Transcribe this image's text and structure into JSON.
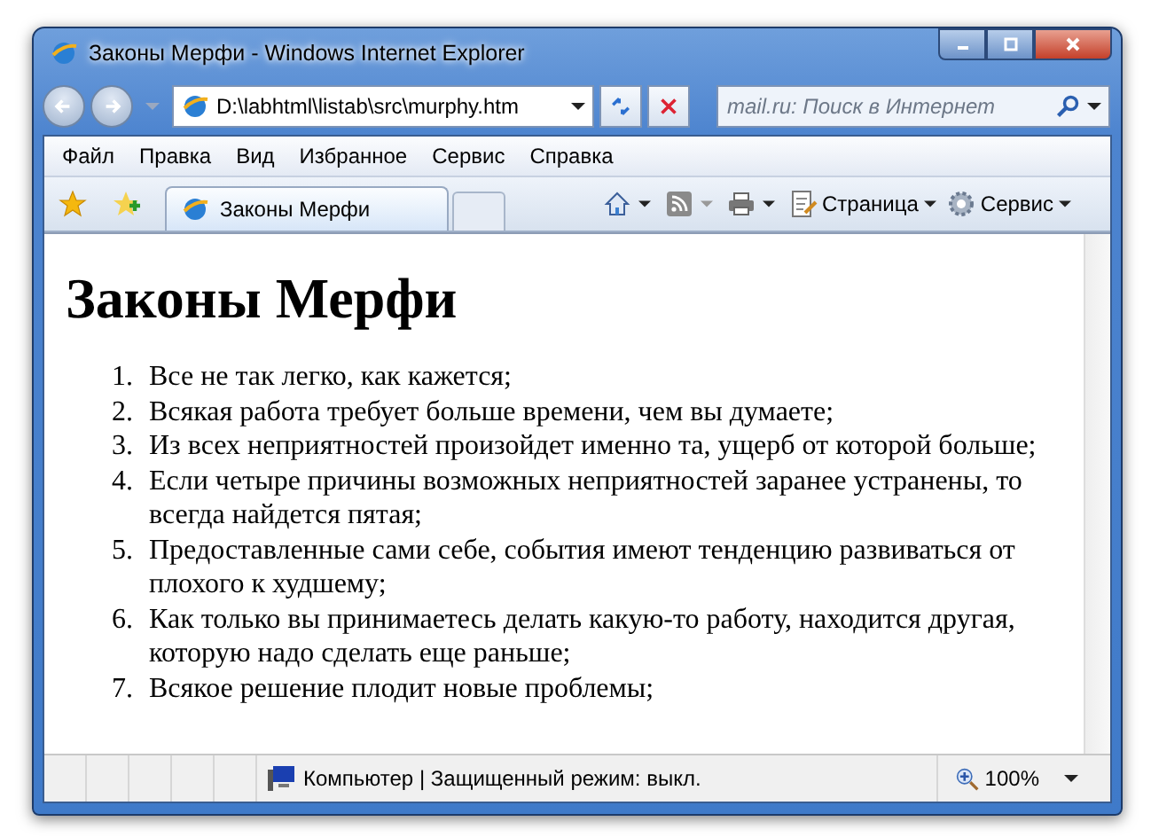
{
  "window": {
    "title": "Законы Мерфи - Windows Internet Explorer"
  },
  "address_bar": {
    "value": "D:\\labhtml\\listab\\src\\murphy.htm"
  },
  "search": {
    "placeholder": "mail.ru: Поиск в Интернет"
  },
  "menu": [
    "Файл",
    "Правка",
    "Вид",
    "Избранное",
    "Сервис",
    "Справка"
  ],
  "tabs": [
    {
      "label": "Законы Мерфи",
      "selected": true
    }
  ],
  "command_bar": [
    {
      "kind": "page",
      "label": "Страница"
    },
    {
      "kind": "tools",
      "label": "Сервис"
    }
  ],
  "page": {
    "heading": "Законы Мерфи",
    "items": [
      {
        "marker": "1.",
        "text": "Все не так легко, как кажется;"
      },
      {
        "marker": "2.",
        "text": "Всякая работа требует больше времени, чем вы думаете;"
      },
      {
        "marker": "3.",
        "text": "Из всех неприятностей произойдет именно та, ущерб от которой больше;"
      },
      {
        "marker": "4.",
        "text": "Если четыре причины возможных неприятностей заранее устранены, то всегда найдется пятая;"
      },
      {
        "marker": "5.",
        "text": "Предоставленные сами себе, события имеют тенденцию развиваться от плохого к худшему;"
      },
      {
        "marker": "6.",
        "text": "Как только вы принимаетесь делать какую-то работу, находится другая, которую надо сделать еще раньше;"
      },
      {
        "marker": "7.",
        "text": "Всякое решение плодит новые проблемы;"
      }
    ]
  },
  "status_bar": {
    "zone": "Компьютер | Защищенный режим: выкл.",
    "zoom": "100%"
  }
}
